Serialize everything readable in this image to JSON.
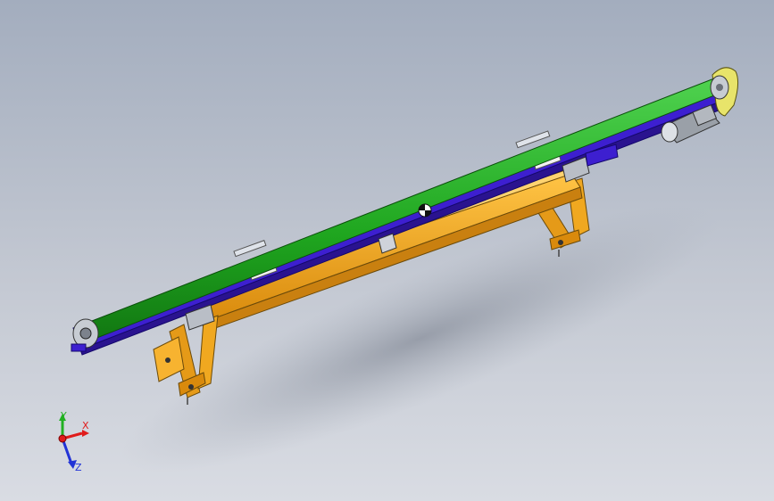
{
  "viewport": {
    "background_top": "#a3adbe",
    "background_bottom": "#d9dce3"
  },
  "model": {
    "parts": [
      "belt-roller",
      "conveyor-frame",
      "support-beam",
      "support-legs",
      "drive-motor",
      "pulley-housing",
      "idler-rollers"
    ],
    "colors": {
      "belt": "#1fa61f",
      "frame": "#3d1fd0",
      "beam": "#f2a51c",
      "housing": "#e8e46a",
      "motor": "#9aa0a8"
    }
  },
  "triad": {
    "x_label": "X",
    "y_label": "Y",
    "z_label": "Z",
    "x_color": "#e01b1b",
    "y_color": "#22b022",
    "z_color": "#2233d6"
  }
}
